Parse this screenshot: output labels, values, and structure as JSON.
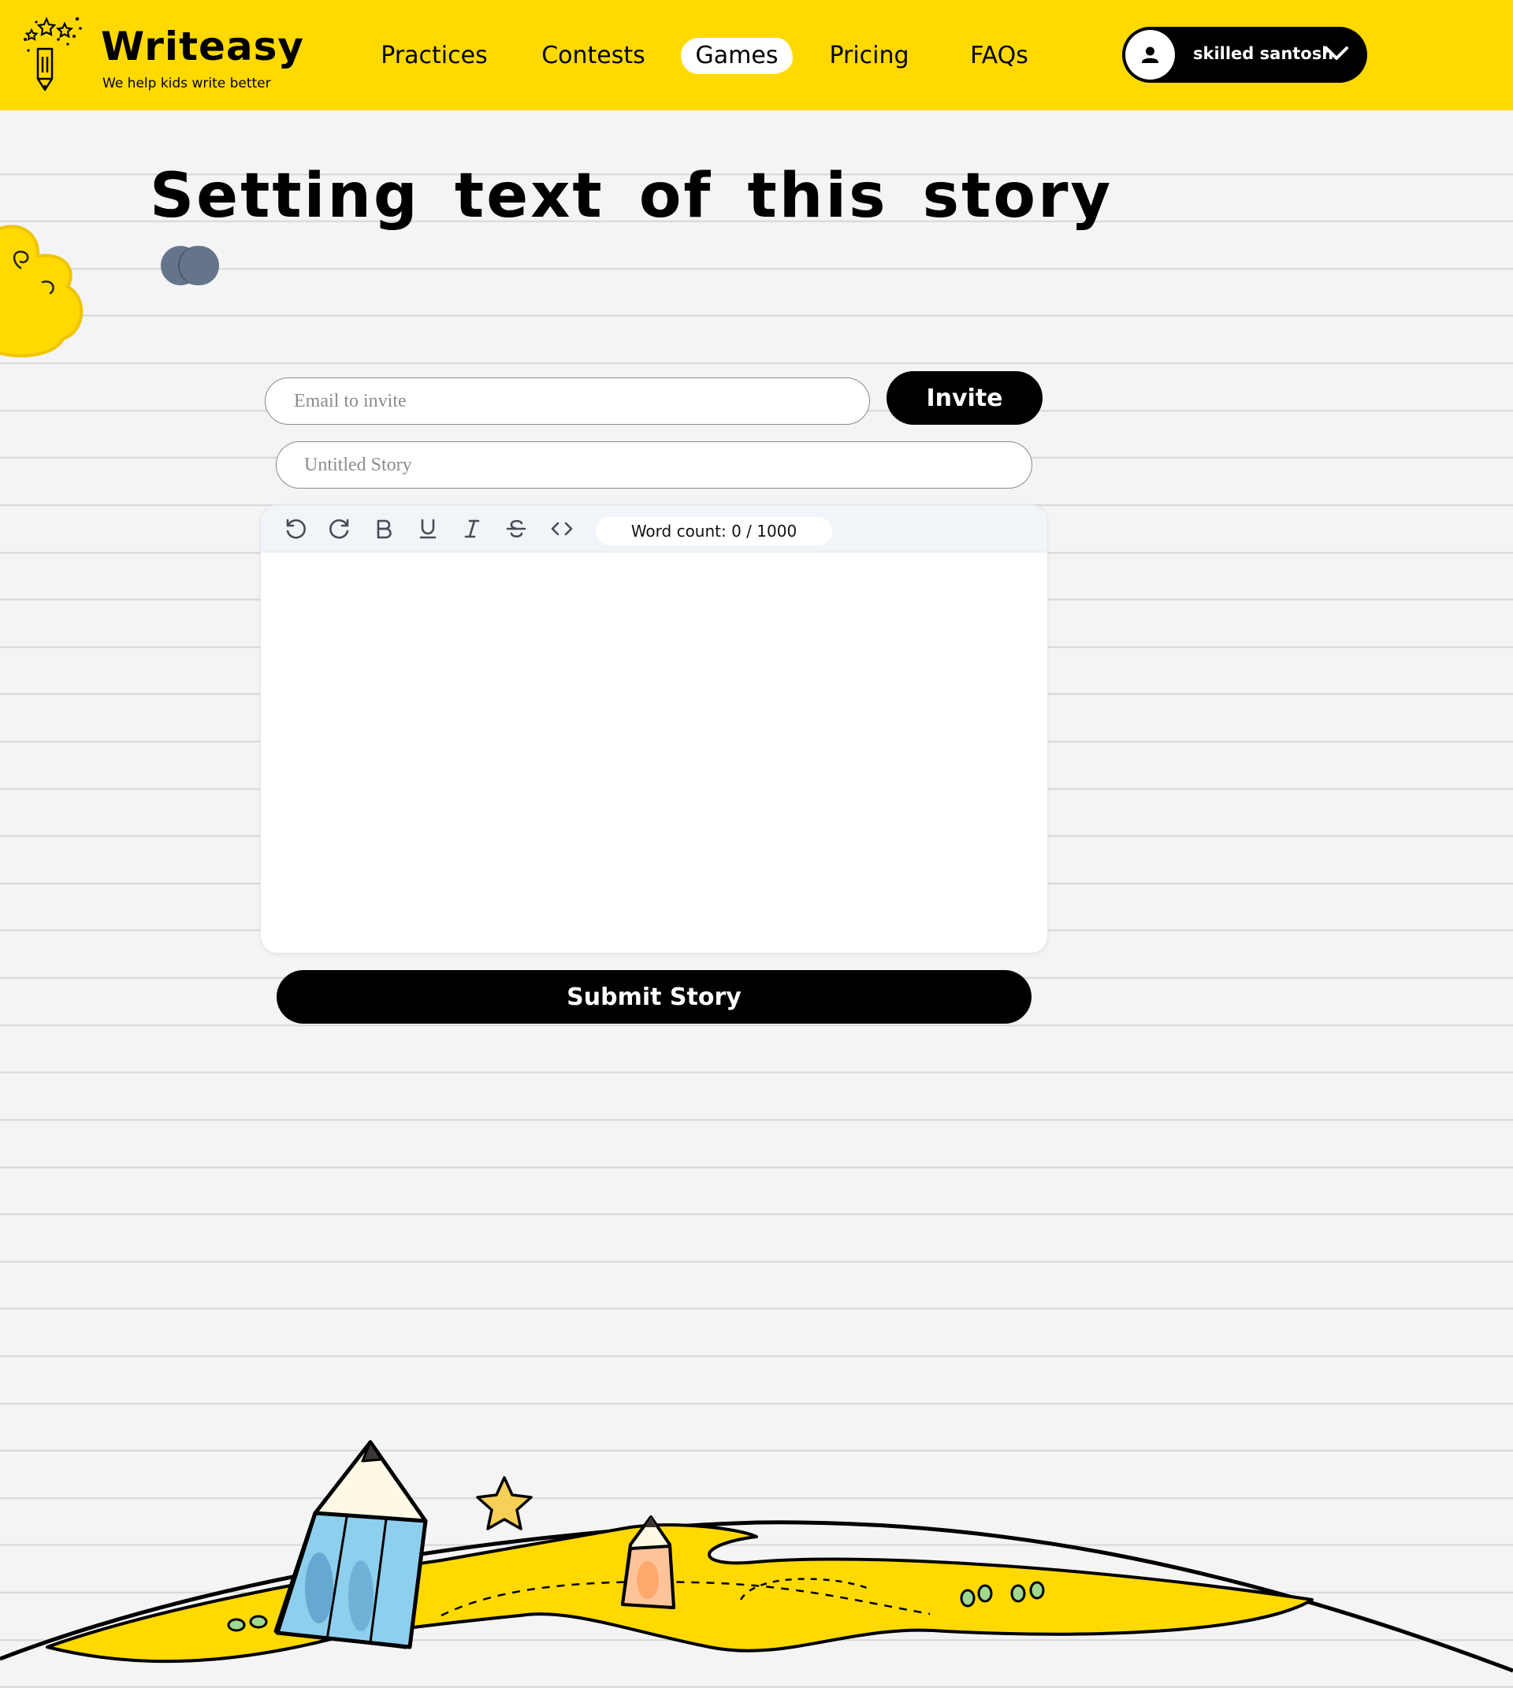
{
  "brand": {
    "name": "Writeasy",
    "tagline": "We help kids write better"
  },
  "nav": [
    {
      "label": "Practices",
      "active": false
    },
    {
      "label": "Contests",
      "active": false
    },
    {
      "label": "Games",
      "active": true
    },
    {
      "label": "Pricing",
      "active": false
    },
    {
      "label": "FAQs",
      "active": false
    }
  ],
  "user": {
    "name": "skilled santosh",
    "icon": "user-icon",
    "menu_icon": "chevron-down-icon"
  },
  "page": {
    "title": "Setting text of this story"
  },
  "invite": {
    "email_placeholder": "Email to invite",
    "email_value": "",
    "button_label": "Invite"
  },
  "story": {
    "title_placeholder": "Untitled Story",
    "title_value": ""
  },
  "editor": {
    "tools": [
      "undo-icon",
      "redo-icon",
      "bold-icon",
      "underline-icon",
      "italic-icon",
      "strikethrough-icon",
      "code-icon"
    ],
    "word_count": "Word count: 0 / 1000",
    "content": ""
  },
  "submit": {
    "label": "Submit Story"
  },
  "colors": {
    "brand_yellow": "#ffd900",
    "button_black": "#000000",
    "avatar_slate": "#64748b",
    "page_bg": "#f4f4f5"
  }
}
